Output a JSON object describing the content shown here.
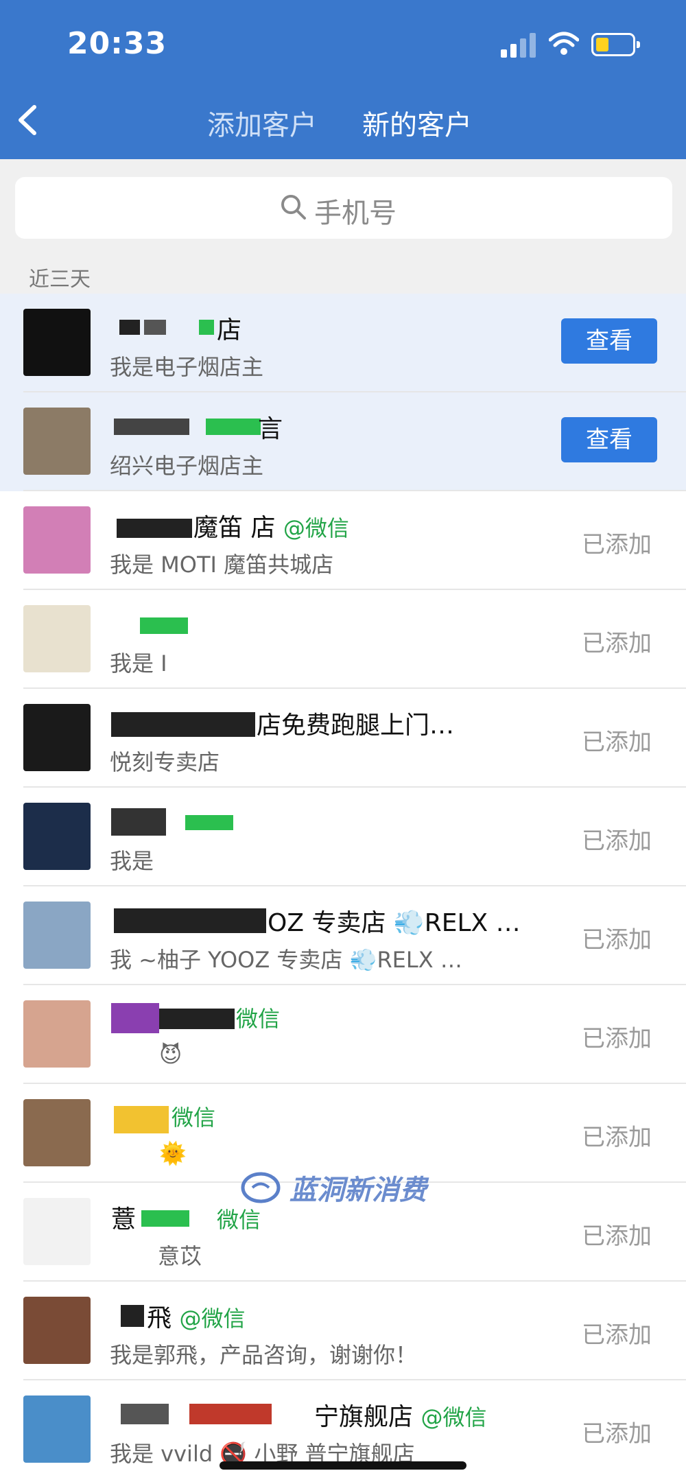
{
  "status_bar": {
    "time": "20:33"
  },
  "nav": {
    "tab_add": "添加客户",
    "tab_new": "新的客户"
  },
  "search": {
    "placeholder": "手机号"
  },
  "section_label": "近三天",
  "button_view": "查看",
  "status_added": "已添加",
  "watermark": "蓝洞新消费",
  "rows": [
    {
      "name": "店",
      "tag": "",
      "sub": "我是电子烟店主",
      "action": "view",
      "avatar_color": "#111111"
    },
    {
      "name": "言",
      "tag": "",
      "sub": "绍兴电子烟店主",
      "action": "view",
      "avatar_color": "#8c7b66"
    },
    {
      "name": "魔笛 店",
      "tag": "@微信",
      "sub": "我是 MOTI 魔笛共城店",
      "action": "added",
      "avatar_color": "#d27fb6"
    },
    {
      "name": "",
      "tag": "",
      "sub": "我是 I",
      "action": "added",
      "avatar_color": "#e8e1cf"
    },
    {
      "name": "店免费跑腿上门…",
      "tag": "",
      "sub": "悦刻专卖店",
      "action": "added",
      "avatar_color": "#1a1a1a"
    },
    {
      "name": "",
      "tag": "",
      "sub": "我是",
      "action": "added",
      "avatar_color": "#1c2d4a"
    },
    {
      "name": "OZ 专卖店 💨RELX …",
      "tag": "",
      "sub": "我 ~柚子 YOOZ 专卖店 💨RELX …",
      "action": "added",
      "avatar_color": "#8aa6c4"
    },
    {
      "name": "",
      "tag": "微信",
      "sub": "😈",
      "action": "added",
      "avatar_color": "#d6a48f"
    },
    {
      "name": "",
      "tag": "微信",
      "sub": "🌞",
      "action": "added",
      "avatar_color": "#8a6a4f"
    },
    {
      "name": "薏",
      "tag": "微信",
      "sub": "意苡",
      "action": "added",
      "avatar_color": "#f2f2f2"
    },
    {
      "name": "飛",
      "tag": "@微信",
      "sub": "我是郭飛，产品咨询，谢谢你！",
      "action": "added",
      "avatar_color": "#7a4b36"
    },
    {
      "name": "宁旗舰店",
      "tag": "@微信",
      "sub": "我是 vvild 🚭 小野 普宁旗舰店",
      "action": "added",
      "avatar_color": "#4a8ec9"
    }
  ]
}
